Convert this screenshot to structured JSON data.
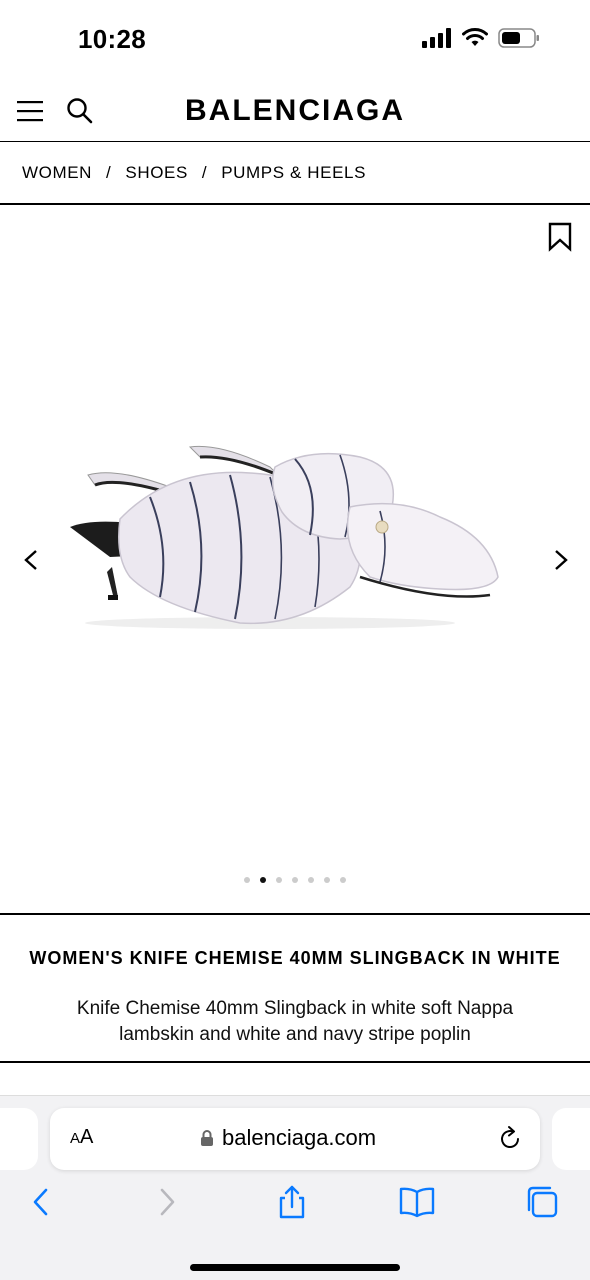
{
  "status_bar": {
    "time": "10:28"
  },
  "header": {
    "brand": "BALENCIAGA",
    "menu_icon": "hamburger-menu-icon",
    "search_icon": "search-icon"
  },
  "breadcrumb": {
    "items": [
      "WOMEN",
      "SHOES",
      "PUMPS & HEELS"
    ],
    "separator": "/"
  },
  "gallery": {
    "image_count": 7,
    "active_index": 1,
    "wishlist_icon": "bookmark-icon",
    "prev_icon": "chevron-left-icon",
    "next_icon": "chevron-right-icon"
  },
  "product": {
    "title": "WOMEN'S KNIFE CHEMISE 40MM SLINGBACK IN WHITE",
    "description": "Knife Chemise 40mm Slingback in white soft Nappa lambskin and white and navy stripe poplin"
  },
  "browser": {
    "text_size_label": "AA",
    "url": "balenciaga.com",
    "accent_color": "#0a7aff"
  }
}
